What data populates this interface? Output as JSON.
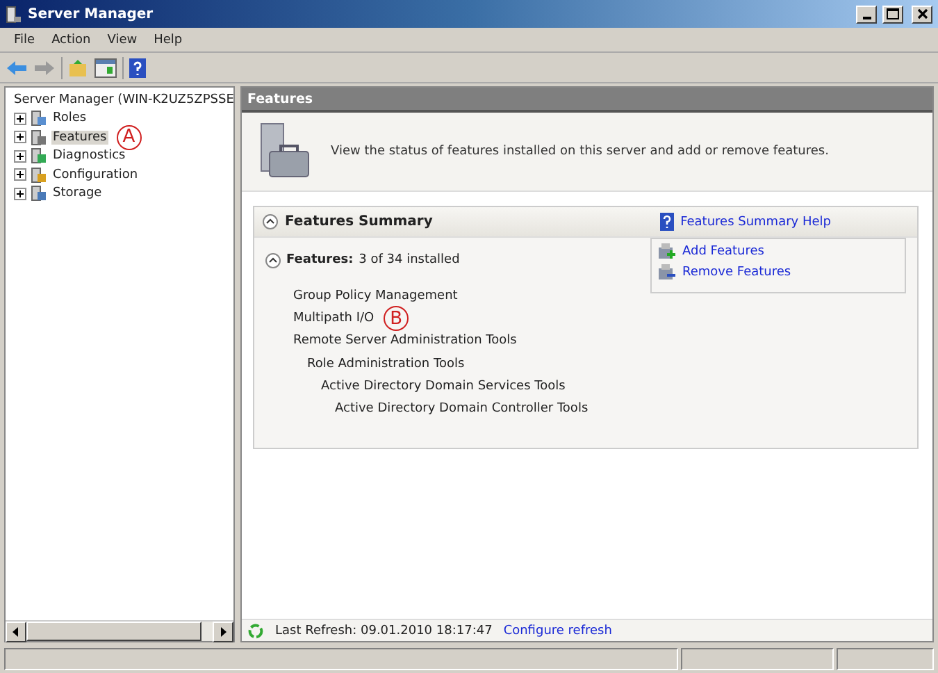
{
  "window": {
    "title": "Server Manager"
  },
  "menu": [
    {
      "label": "File"
    },
    {
      "label": "Action"
    },
    {
      "label": "View"
    },
    {
      "label": "Help"
    }
  ],
  "tree": {
    "label": "Server Manager (WIN-K2UZ5ZPSSE",
    "items": [
      {
        "label": "Roles",
        "kind": "roles",
        "selected": false,
        "expanded": false
      },
      {
        "label": "Features",
        "kind": "features",
        "selected": true,
        "expanded": false,
        "callout": "A"
      },
      {
        "label": "Diagnostics",
        "kind": "diagnostics",
        "selected": false,
        "expanded": false
      },
      {
        "label": "Configuration",
        "kind": "configuration",
        "selected": false,
        "expanded": false
      },
      {
        "label": "Storage",
        "kind": "storage",
        "selected": false,
        "expanded": false
      }
    ]
  },
  "content": {
    "header": "Features",
    "description": "View the status of features installed on this server and add or remove features.",
    "summary": {
      "title": "Features Summary",
      "expanded": true,
      "help_link": "Features Summary Help",
      "features": {
        "label": "Features:",
        "count": "3 of 34 installed",
        "expanded": true,
        "items": [
          {
            "label": "Group Policy Management"
          },
          {
            "label": "Multipath I/O",
            "callout": "B"
          },
          {
            "label": "Remote Server Administration Tools",
            "children": [
              {
                "label": "Role Administration Tools",
                "children": [
                  {
                    "label": "Active Directory Domain Services Tools",
                    "children": [
                      {
                        "label": "Active Directory Domain Controller Tools"
                      }
                    ]
                  }
                ]
              }
            ]
          }
        ]
      },
      "actions": [
        {
          "label": "Add Features",
          "kind": "add"
        },
        {
          "label": "Remove Features",
          "kind": "remove"
        }
      ]
    },
    "footer": {
      "last_refresh": "Last Refresh: 09.01.2010 18:17:47",
      "configure_link": "Configure refresh"
    }
  }
}
